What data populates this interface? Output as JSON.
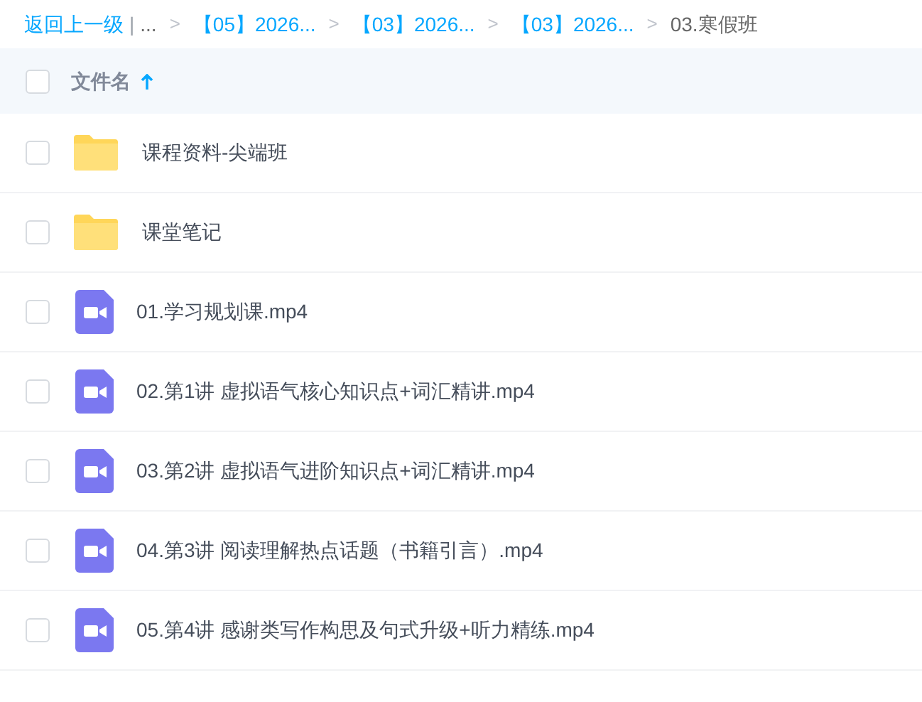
{
  "breadcrumb": {
    "back": "返回上一级",
    "divider": "|",
    "items": [
      {
        "kind": "ellipsis",
        "label": "..."
      },
      {
        "kind": "link",
        "separator": ">",
        "label": "【05】2026..."
      },
      {
        "kind": "link",
        "separator": ">",
        "label": "【03】2026..."
      },
      {
        "kind": "link",
        "separator": ">",
        "label": "【03】2026..."
      },
      {
        "kind": "current",
        "separator": ">",
        "label": "03.寒假班"
      }
    ]
  },
  "table": {
    "header": {
      "checked": false,
      "column": "文件名"
    },
    "rows": [
      {
        "kind": "folder",
        "name": "课程资料-尖端班",
        "checked": false
      },
      {
        "kind": "folder",
        "name": "课堂笔记",
        "checked": false
      },
      {
        "kind": "video",
        "name": "01.学习规划课.mp4",
        "checked": false
      },
      {
        "kind": "video",
        "name": "02.第1讲 虚拟语气核心知识点+词汇精讲.mp4",
        "checked": false
      },
      {
        "kind": "video",
        "name": "03.第2讲 虚拟语气进阶知识点+词汇精讲.mp4",
        "checked": false
      },
      {
        "kind": "video",
        "name": "04.第3讲 阅读理解热点话题（书籍引言）.mp4",
        "checked": false
      },
      {
        "kind": "video",
        "name": "05.第4讲 感谢类写作构思及句式升级+听力精练.mp4",
        "checked": false
      }
    ]
  }
}
